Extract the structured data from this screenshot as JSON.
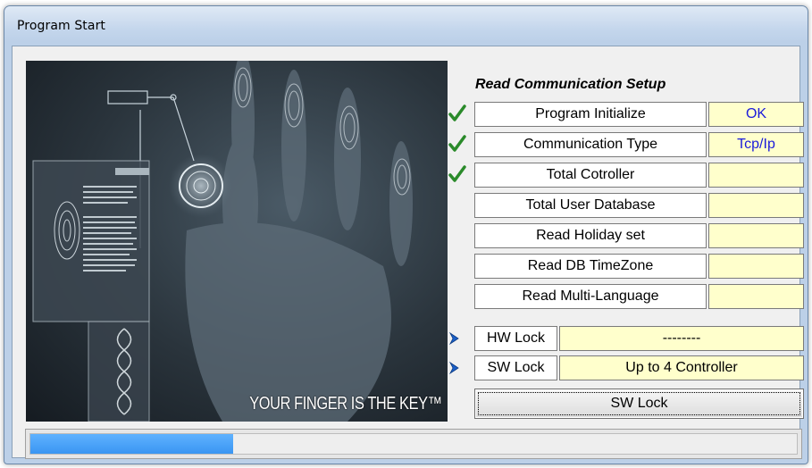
{
  "window": {
    "title": "Program Start"
  },
  "image": {
    "slogan": "YOUR FINGER IS THE KEY™"
  },
  "setup": {
    "title": "Read Communication Setup",
    "items": [
      {
        "label": "Program Initialize",
        "value": "OK",
        "checked": true
      },
      {
        "label": "Communication Type",
        "value": "Tcp/Ip",
        "checked": true
      },
      {
        "label": "Total Cotroller",
        "value": "",
        "checked": true
      },
      {
        "label": "Total User Database",
        "value": "",
        "checked": false
      },
      {
        "label": "Read Holiday set",
        "value": "",
        "checked": false
      },
      {
        "label": "Read DB TimeZone",
        "value": "",
        "checked": false
      },
      {
        "label": "Read Multi-Language",
        "value": "",
        "checked": false
      }
    ]
  },
  "locks": {
    "hw": {
      "label": "HW Lock",
      "value": "--------",
      "icon": "blue-arrow-icon"
    },
    "sw": {
      "label": "SW Lock",
      "value": "Up to 4 Controller",
      "icon": "blue-arrow-icon"
    }
  },
  "sw_button": {
    "label": "SW Lock"
  },
  "progress": {
    "fraction": 0.265
  },
  "colors": {
    "value_bg": "#ffffcc",
    "value_text": "#1a1adb",
    "check": "#2a8a2a",
    "progress": "#3a95f2",
    "arrow": "#1a5fc8"
  }
}
